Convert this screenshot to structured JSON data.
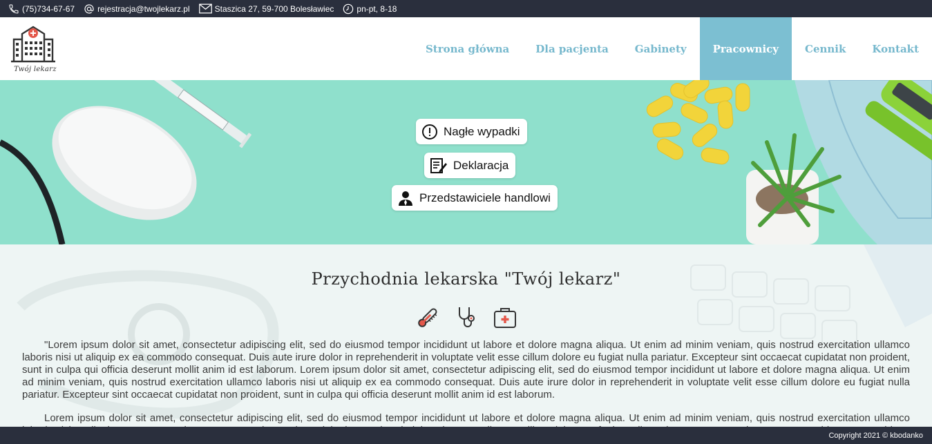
{
  "topbar": {
    "phone": "(75)734-67-67",
    "email": "rejestracja@twojlekarz.pl",
    "address": "Staszica 27, 59-700 Bolesławiec",
    "hours": "pn-pt, 8-18"
  },
  "logo": {
    "text": "Twój lekarz"
  },
  "nav": {
    "items": [
      {
        "label": "Strona główna"
      },
      {
        "label": "Dla pacjenta"
      },
      {
        "label": "Gabinety"
      },
      {
        "label": "Pracownicy",
        "active": true
      },
      {
        "label": "Cennik"
      },
      {
        "label": "Kontakt"
      }
    ]
  },
  "hero": {
    "buttons": [
      {
        "label": "Nagłe wypadki",
        "icon": "exclamation-icon"
      },
      {
        "label": "Deklaracja",
        "icon": "document-pen-icon"
      },
      {
        "label": "Przedstawiciele handlowi",
        "icon": "person-icon"
      }
    ]
  },
  "main": {
    "title": "Przychodnia lekarska \"Twój lekarz\"",
    "icons": [
      "thermometer-icon",
      "stethoscope-icon",
      "first-aid-kit-icon"
    ],
    "paragraph1": "\"Lorem ipsum dolor sit amet, consectetur adipiscing elit, sed do eiusmod tempor incididunt ut labore et dolore magna aliqua. Ut enim ad minim veniam, quis nostrud exercitation ullamco laboris nisi ut aliquip ex ea commodo consequat. Duis aute irure dolor in reprehenderit in voluptate velit esse cillum dolore eu fugiat nulla pariatur. Excepteur sint occaecat cupidatat non proident, sunt in culpa qui officia deserunt mollit anim id est laborum. Lorem ipsum dolor sit amet, consectetur adipiscing elit, sed do eiusmod tempor incididunt ut labore et dolore magna aliqua. Ut enim ad minim veniam, quis nostrud exercitation ullamco laboris nisi ut aliquip ex ea commodo consequat. Duis aute irure dolor in reprehenderit in voluptate velit esse cillum dolore eu fugiat nulla pariatur. Excepteur sint occaecat cupidatat non proident, sunt in culpa qui officia deserunt mollit anim id est laborum.",
    "paragraph2": "Lorem ipsum dolor sit amet, consectetur adipiscing elit, sed do eiusmod tempor incididunt ut labore et dolore magna aliqua. Ut enim ad minim veniam, quis nostrud exercitation ullamco laboris nisi ut aliquip ex ea commodo consequat. Duis aute irure dolor in reprehenderit in voluptate velit esse cillum dolore eu fugiat nulla pariatur. Excepteur sint occaecat cupidatat non proident, sunt in culpa qui officia deserunt mollit anim id est laborum.\""
  },
  "footer": {
    "copyright": "Copyright 2021 © kbodanko"
  },
  "colors": {
    "dark": "#2a2f3d",
    "accent": "#7cbfd2",
    "hero": "#8fe0cc"
  }
}
